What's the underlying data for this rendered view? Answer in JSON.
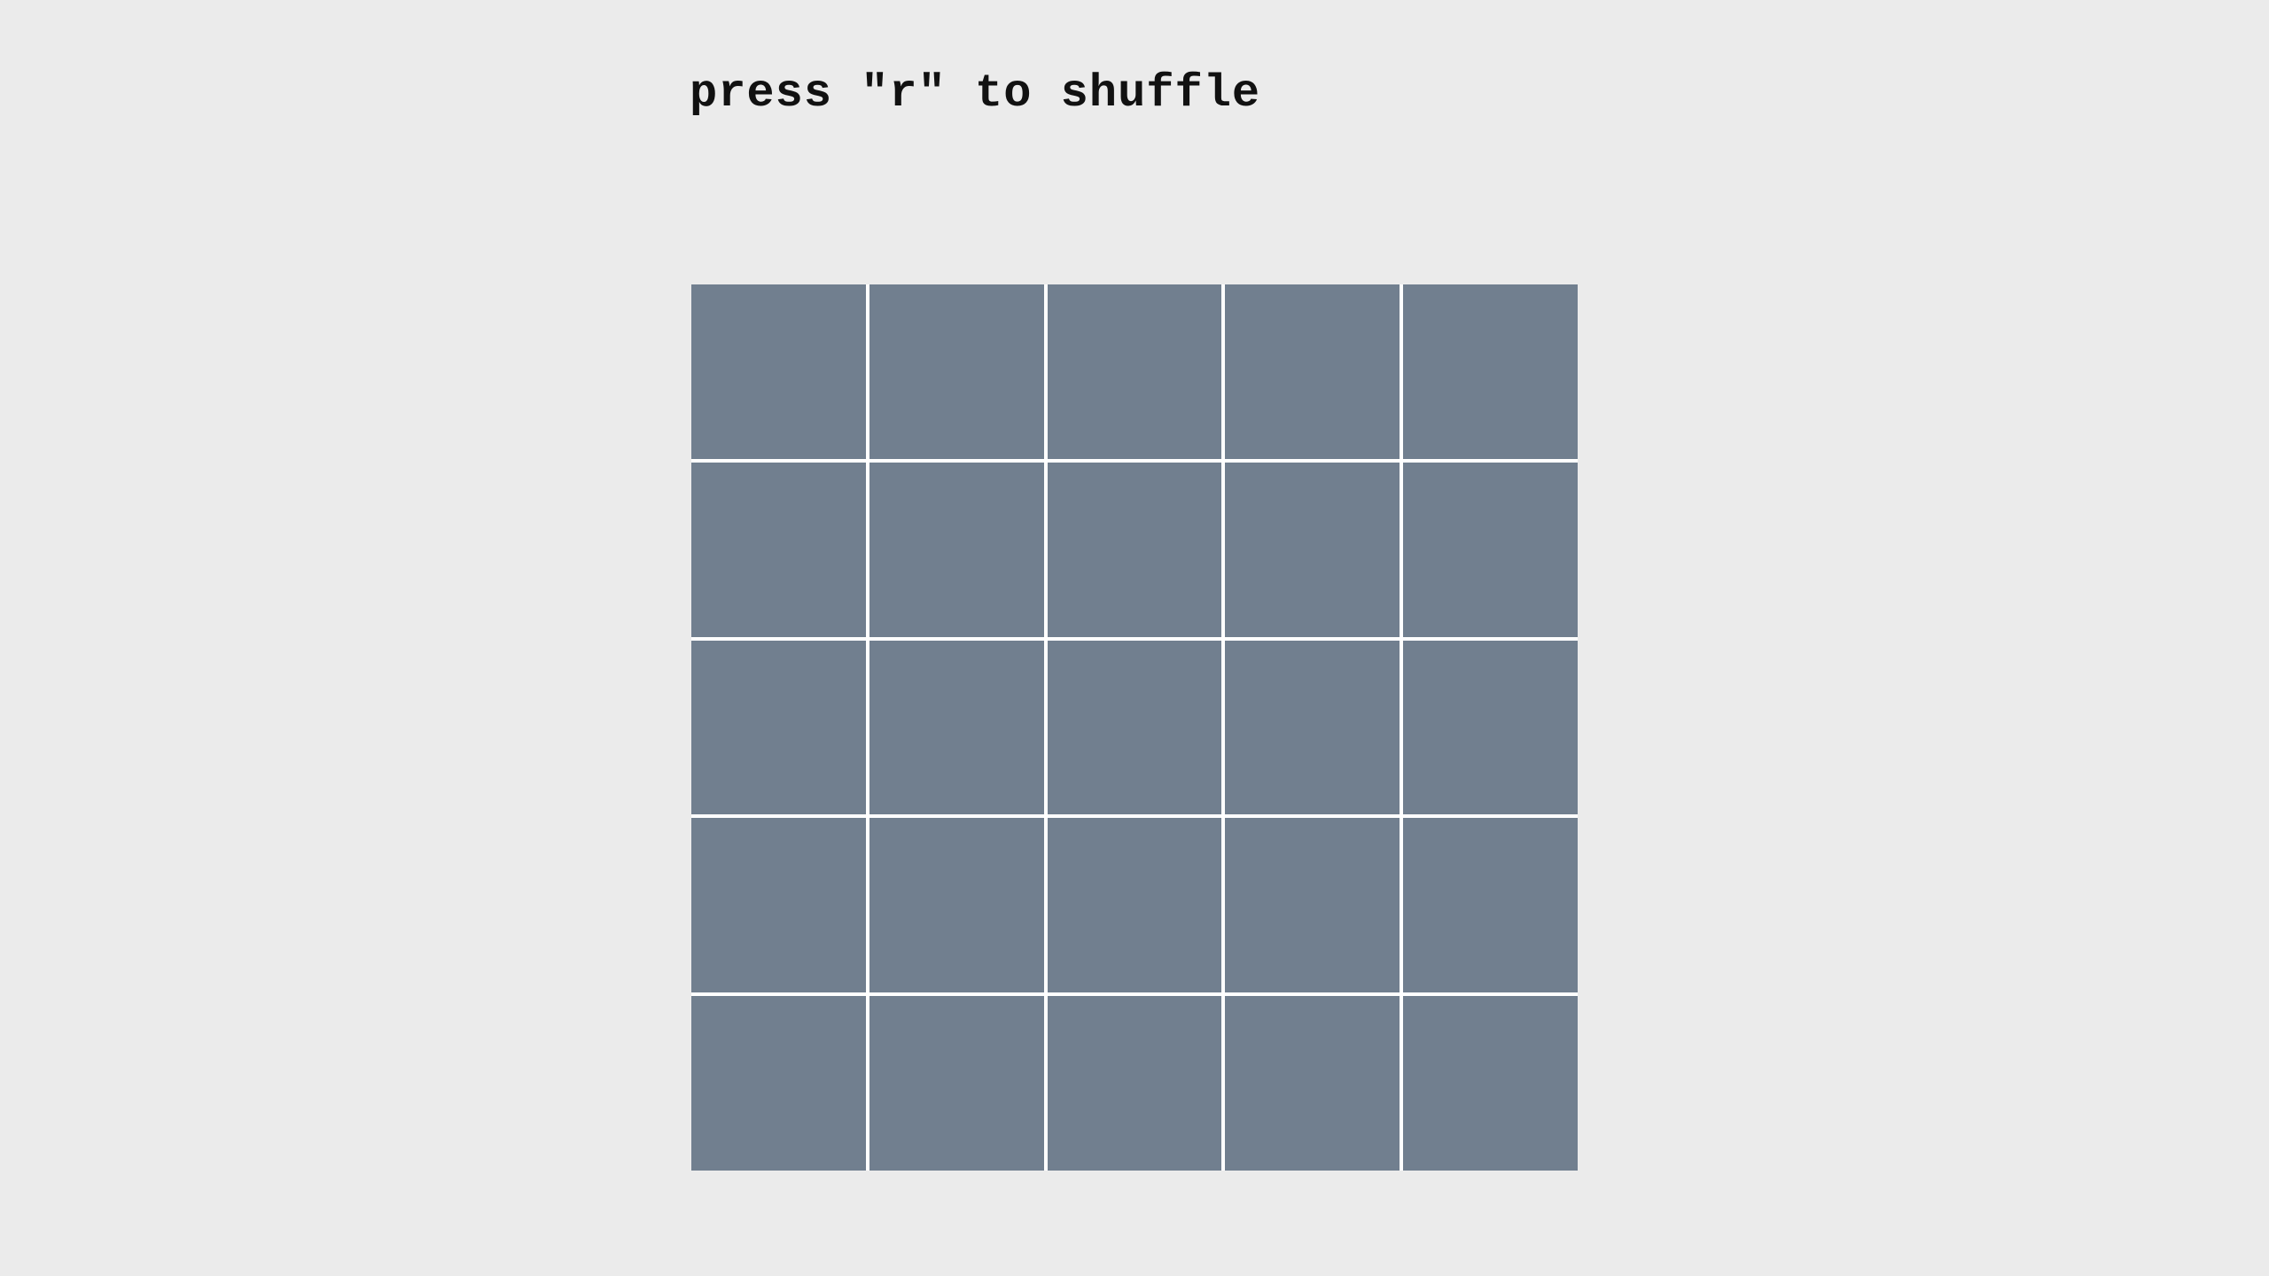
{
  "instruction": {
    "text": "press \"r\" to shuffle"
  },
  "board": {
    "rows": 5,
    "columns": 5,
    "tile_color": "#717f8f",
    "grid_line_color": "#ffffff",
    "background_color": "#ebebeb"
  }
}
